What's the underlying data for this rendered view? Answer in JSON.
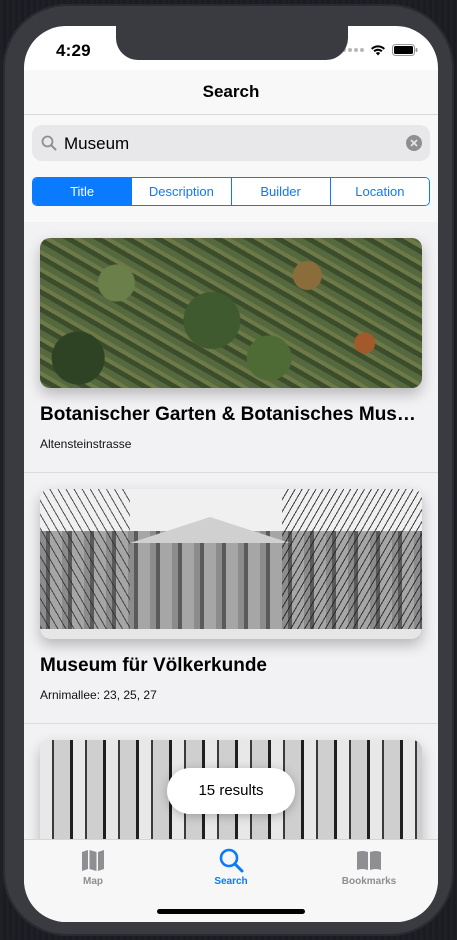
{
  "status_bar": {
    "time": "4:29"
  },
  "nav": {
    "title": "Search"
  },
  "search": {
    "value": "Museum",
    "placeholder": ""
  },
  "segments": [
    {
      "label": "Title",
      "selected": true
    },
    {
      "label": "Description",
      "selected": false
    },
    {
      "label": "Builder",
      "selected": false
    },
    {
      "label": "Location",
      "selected": false
    }
  ],
  "results": [
    {
      "title": "Botanischer Garten & Botanisches Museum",
      "address": "Altensteinstrasse",
      "image": "aerial-photo"
    },
    {
      "title": "Museum für Völkerkunde",
      "address": "Arnimallee: 23, 25, 27",
      "image": "museum-building-photo"
    },
    {
      "title": "",
      "address": "",
      "image": "park-photo"
    }
  ],
  "toast": {
    "text": "15 results"
  },
  "tabs": [
    {
      "label": "Map",
      "icon": "map-icon",
      "active": false
    },
    {
      "label": "Search",
      "icon": "search-icon",
      "active": true
    },
    {
      "label": "Bookmarks",
      "icon": "bookmarks-icon",
      "active": false
    }
  ],
  "colors": {
    "accent": "#0a7aff",
    "inactive": "#8e8e93",
    "frame": "#3a3b40"
  }
}
